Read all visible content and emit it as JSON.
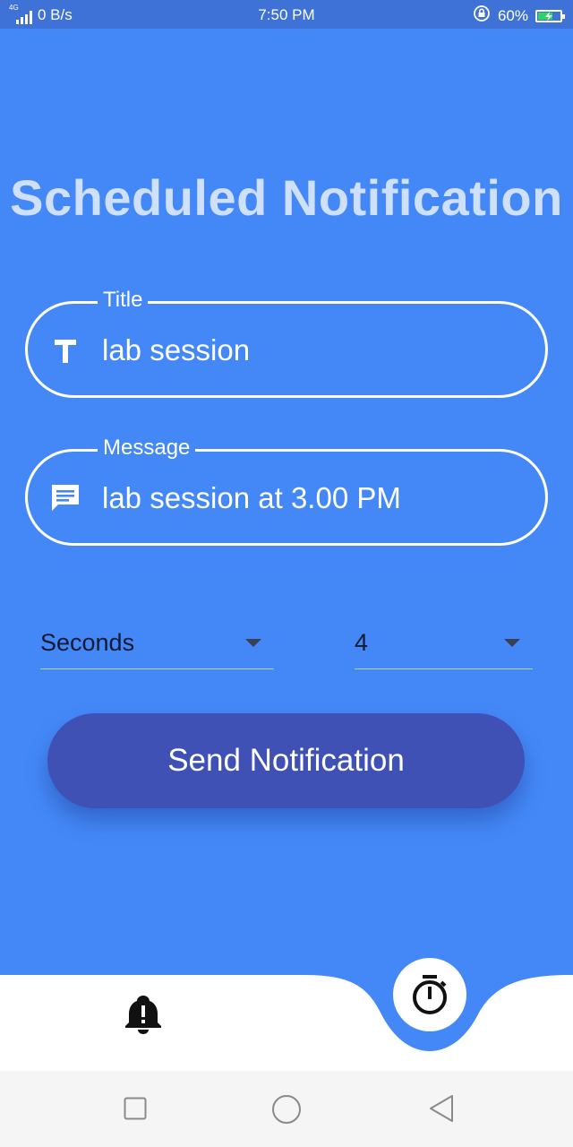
{
  "status_bar": {
    "network_type": "4G",
    "data_rate": "0 B/s",
    "time": "7:50 PM",
    "battery": "60%",
    "battery_level": 0.6
  },
  "screen": {
    "title": "Scheduled Notification",
    "title_field": {
      "label": "Title",
      "value": "lab session",
      "icon": "text-icon"
    },
    "message_field": {
      "label": "Message",
      "value": "lab session at 3.00 PM",
      "icon": "message-icon"
    },
    "unit_select": {
      "value": "Seconds"
    },
    "amount_select": {
      "value": "4"
    },
    "send_button": {
      "label": "Send Notification"
    }
  },
  "bottom_nav": {
    "items": [
      {
        "name": "notifications",
        "icon": "bell-alert-icon"
      },
      {
        "name": "timer",
        "icon": "stopwatch-icon",
        "active": true
      }
    ]
  },
  "colors": {
    "background": "#4488f7",
    "status_bar": "#3f72d6",
    "button": "#3f51b5",
    "title": "#cfe0fd"
  }
}
